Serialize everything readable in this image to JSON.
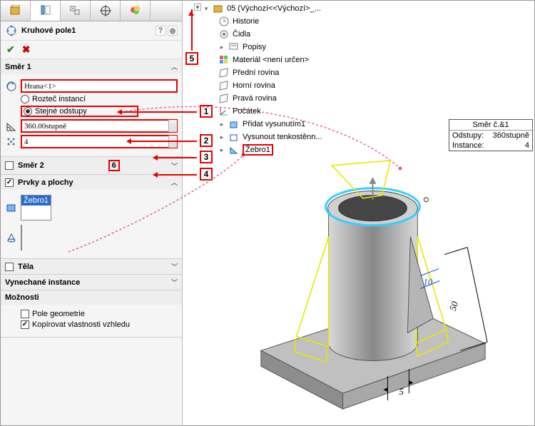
{
  "feature_title": "Kruhové pole1",
  "sections": {
    "smer1": {
      "title": "Směr 1"
    },
    "smer2": {
      "title": "Směr 2"
    },
    "prvky": {
      "title": "Prvky a plochy"
    },
    "tela": {
      "title": "Těla"
    },
    "vynech": {
      "title": "Vynechané instance"
    },
    "moznosti": {
      "title": "Možnosti"
    }
  },
  "smer1": {
    "axis_value": "Hrana<1>",
    "radio1": "Rozteč instancí",
    "radio2": "Stejné odstupy",
    "angle": "360.00stupně",
    "count": "4"
  },
  "prvky": {
    "selected": "Žebro1"
  },
  "moznosti": {
    "pole_geom": "Pole geometrie",
    "kopirovat": "Kopírovat vlastnosti vzhledu"
  },
  "callout_numbers": [
    "1",
    "2",
    "3",
    "4",
    "5",
    "6"
  ],
  "tree": {
    "root": "05  (Výchozí<<Výchozí>_...",
    "items": [
      "Historie",
      "Čidla",
      "Popisy",
      "Materiál <není určen>",
      "Přední rovina",
      "Horní rovina",
      "Pravá rovina",
      "Počátek",
      "Přidat vysunutím1",
      "Vysunout tenkostěnn...",
      "Žebro1"
    ]
  },
  "tooltip": {
    "title": "Směr č.&1",
    "rows": [
      {
        "k": "Odstupy:",
        "v": "360stupně"
      },
      {
        "k": "Instance:",
        "v": "4"
      }
    ]
  },
  "dims": {
    "d1": "10",
    "d2": "50",
    "d3": "5"
  }
}
